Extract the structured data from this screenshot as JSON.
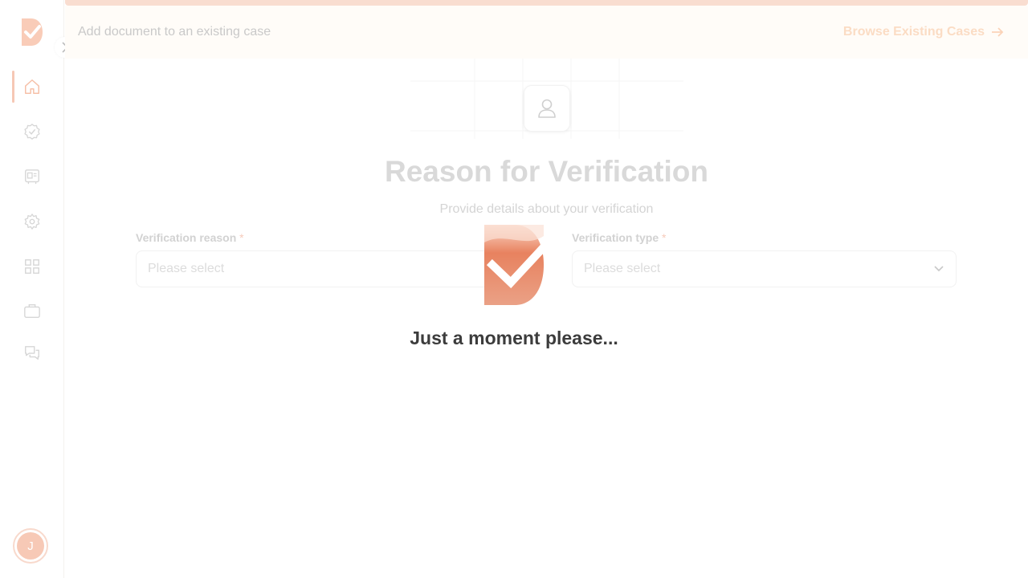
{
  "banner": {
    "text": "Add document to an existing case",
    "link_label": "Browse Existing Cases"
  },
  "sidebar": {
    "items": [
      {
        "name": "home-icon",
        "active": true
      },
      {
        "name": "verified-badge-icon",
        "active": false
      },
      {
        "name": "id-card-icon",
        "active": false
      },
      {
        "name": "gear-icon",
        "active": false
      },
      {
        "name": "apps-grid-icon",
        "active": false
      },
      {
        "name": "briefcase-icon",
        "active": false
      },
      {
        "name": "chat-icon",
        "active": false
      }
    ],
    "avatar_initial": "J"
  },
  "form": {
    "title": "Reason for Verification",
    "subtitle": "Provide details about your verification",
    "reason_label": "Verification reason",
    "reason_placeholder": "Please select",
    "type_label": "Verification type",
    "type_placeholder": "Please select",
    "required_mark": "*"
  },
  "loader": {
    "message": "Just a moment please..."
  },
  "colors": {
    "accent": "#e8825f",
    "accent_light": "#f6c8b5",
    "banner_bg": "#fffcf8"
  }
}
